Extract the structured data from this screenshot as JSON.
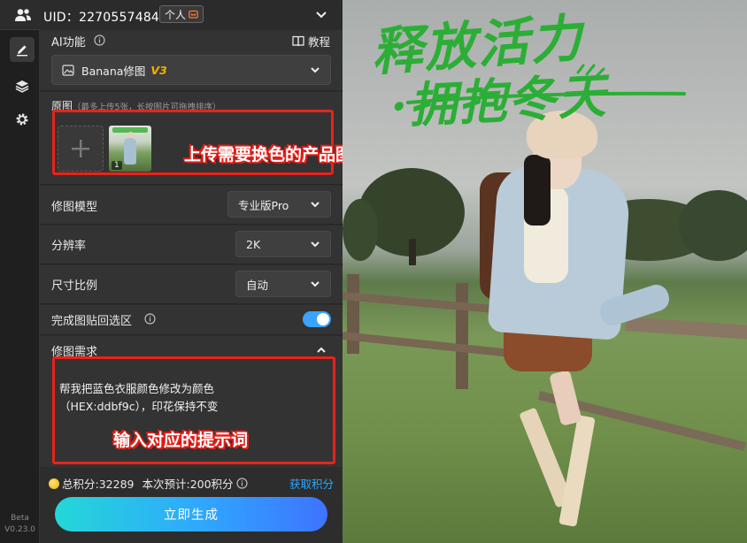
{
  "header": {
    "uid": "UID：2270557484",
    "account_type": "个人",
    "account_icon": "crown-icon"
  },
  "rail": {
    "items": [
      {
        "icon": "edit-icon",
        "active": true
      },
      {
        "icon": "layers-icon",
        "active": false
      },
      {
        "icon": "gear-icon",
        "active": false
      }
    ],
    "version_line1": "Beta",
    "version_line2": "V0.23.0"
  },
  "ai_function": {
    "label": "AI功能",
    "tutorial": "教程",
    "selected_tool": "Banana修图",
    "tool_version": "V3"
  },
  "source_image": {
    "label": "原图",
    "hint": "（最多上传5张，长按图片可拖拽排序）",
    "thumb_index": "1",
    "callout": "上传需要换色的产品图"
  },
  "settings": {
    "model_label": "修图模型",
    "model_value": "专业版Pro",
    "resolution_label": "分辨率",
    "resolution_value": "2K",
    "ratio_label": "尺寸比例",
    "ratio_value": "自动",
    "paste_back_label": "完成图贴回选区",
    "paste_back_on": true
  },
  "prompt": {
    "label": "修图需求",
    "text": "帮我把蓝色衣服颜色修改为颜色\n（HEX:ddbf9c），印花保持不变",
    "callout": "输入对应的提示词"
  },
  "footer": {
    "total_points": "总积分:32289",
    "estimate": "本次预计:200积分",
    "get_points": "获取积分",
    "generate": "立即生成"
  },
  "preview": {
    "title_line1": "释放活力",
    "title_line2": "·拥抱冬天"
  },
  "colors": {
    "accent_blue": "#2ea8ff",
    "callout_red": "#e8231b",
    "tool_version": "#f0b400",
    "title_green": "#2cae36"
  }
}
